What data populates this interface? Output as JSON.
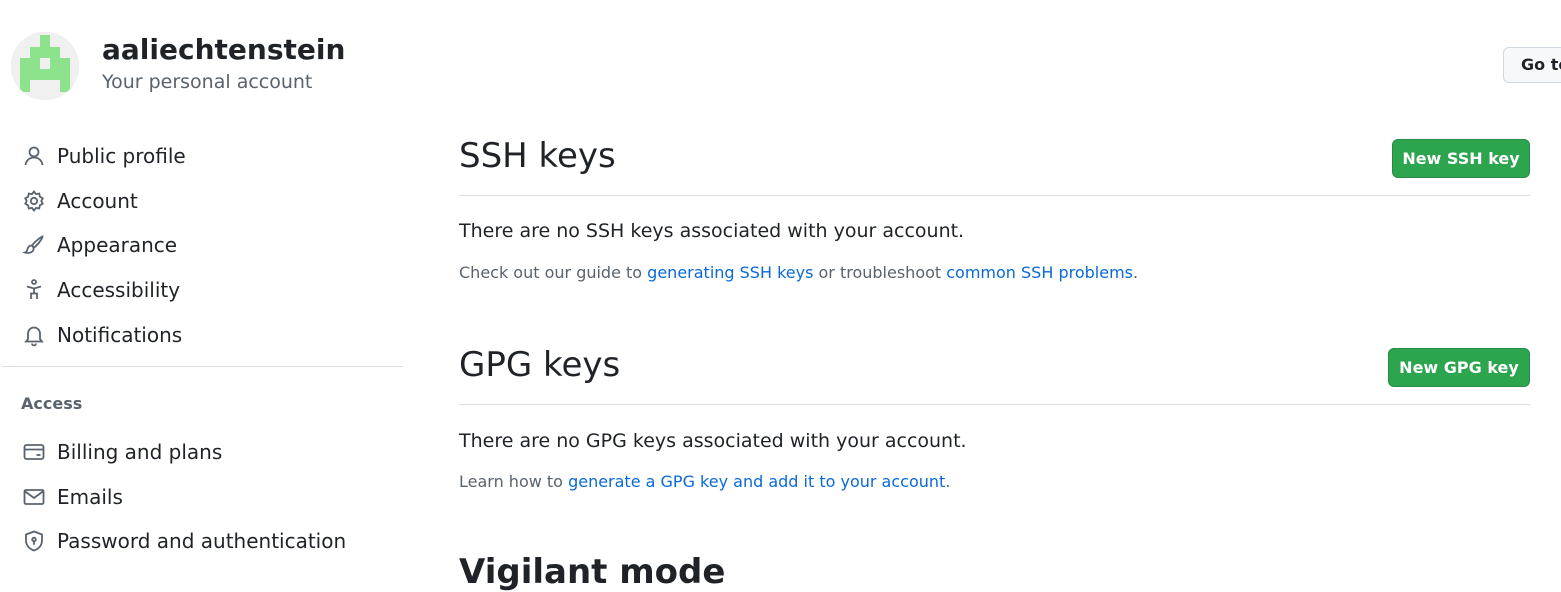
{
  "account": {
    "username": "aaliechtenstein",
    "subtitle": "Your personal account",
    "goto_button_label": "Go to"
  },
  "sidebar": {
    "items": [
      {
        "label": "Public profile",
        "icon": "person-icon"
      },
      {
        "label": "Account",
        "icon": "gear-icon"
      },
      {
        "label": "Appearance",
        "icon": "paintbrush-icon"
      },
      {
        "label": "Accessibility",
        "icon": "accessibility-icon"
      },
      {
        "label": "Notifications",
        "icon": "bell-icon"
      }
    ],
    "access_heading": "Access",
    "access_items": [
      {
        "label": "Billing and plans",
        "icon": "credit-card-icon"
      },
      {
        "label": "Emails",
        "icon": "mail-icon"
      },
      {
        "label": "Password and authentication",
        "icon": "shield-lock-icon"
      }
    ]
  },
  "ssh": {
    "title": "SSH keys",
    "new_button": "New SSH key",
    "empty_message": "There are no SSH keys associated with your account.",
    "help_prefix": "Check out our guide to ",
    "help_link1": "generating SSH keys",
    "help_middle": " or troubleshoot ",
    "help_link2": "common SSH problems",
    "help_suffix": "."
  },
  "gpg": {
    "title": "GPG keys",
    "new_button": "New GPG key",
    "empty_message": "There are no GPG keys associated with your account.",
    "help_prefix": "Learn how to ",
    "help_link": "generate a GPG key and add it to your account",
    "help_suffix": "."
  },
  "next_section": {
    "title_partial": "Vigilant mode"
  },
  "colors": {
    "primary_button": "#2da44e",
    "link": "#0969da",
    "avatar_green": "#8ce38c"
  }
}
